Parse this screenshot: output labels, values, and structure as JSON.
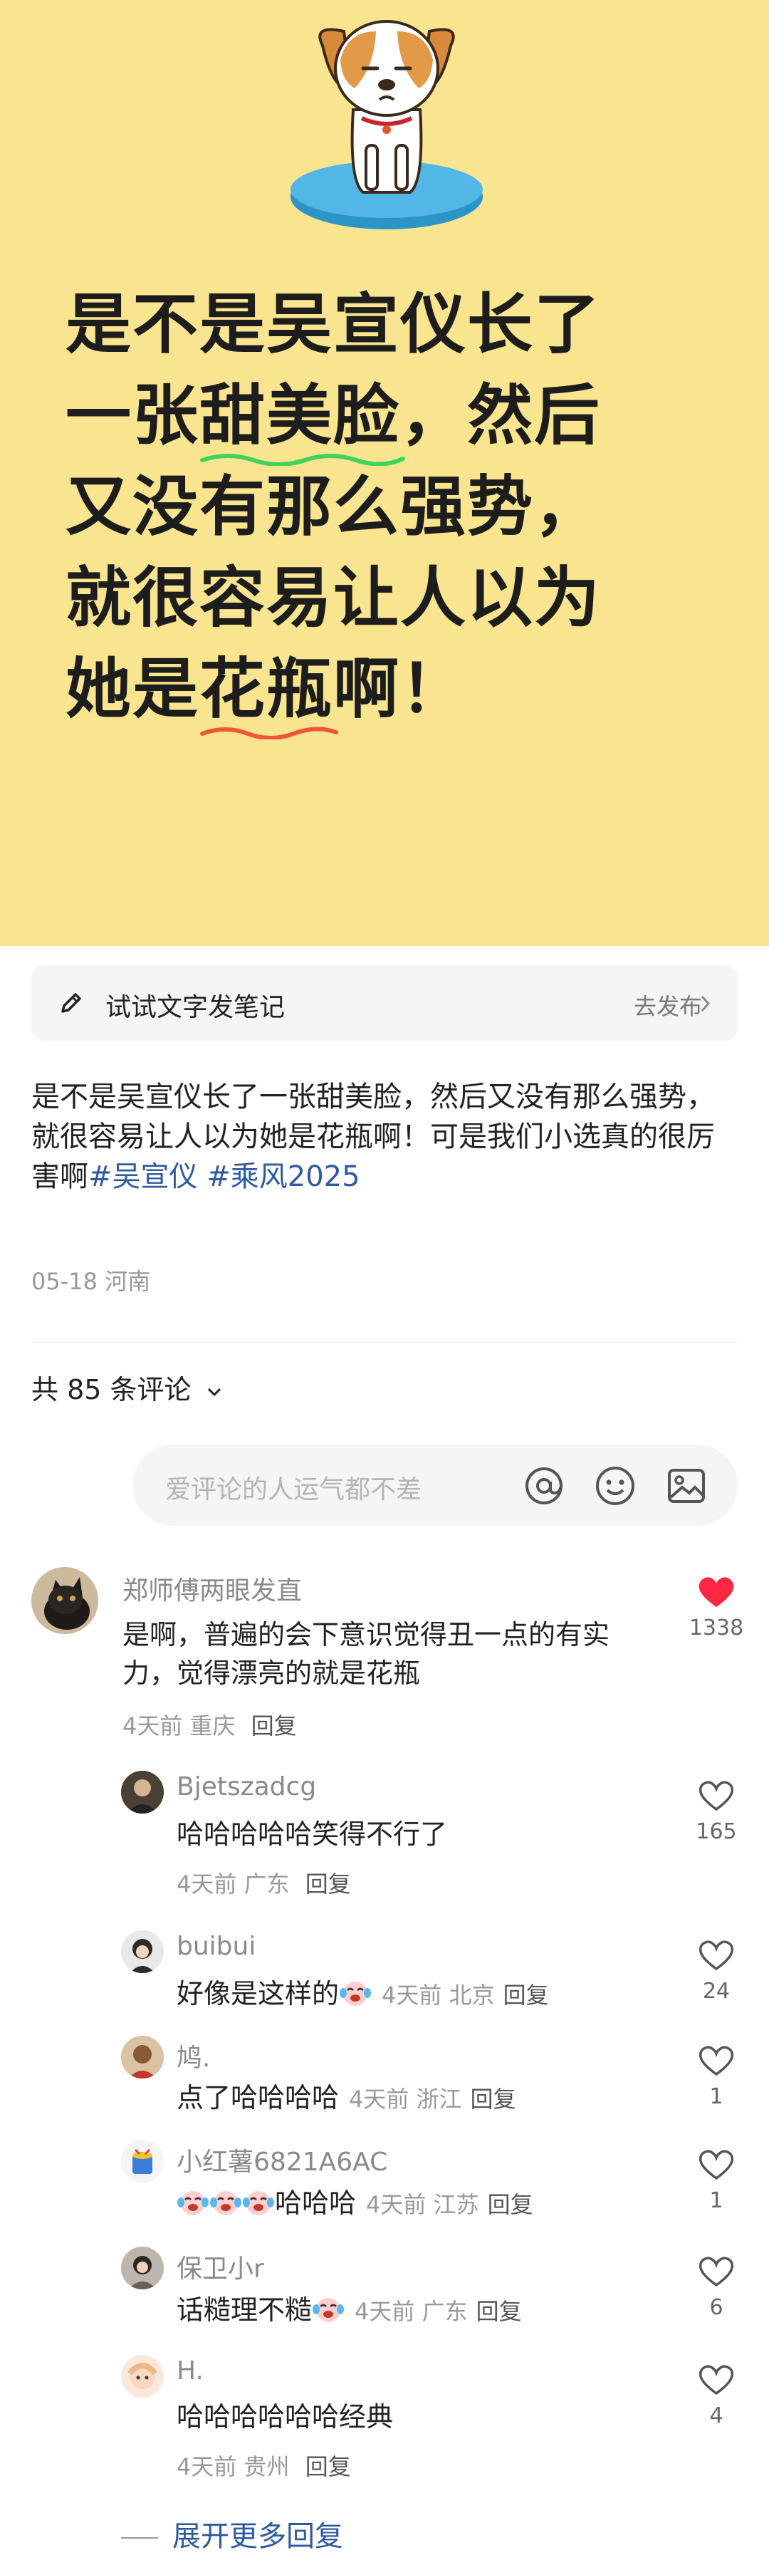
{
  "hero": {
    "line1": "是不是吴宣仪长了",
    "line2_pre": "一张",
    "line2_hl": "甜美脸",
    "line2_post": "，然后",
    "line3": "又没有那么强势，",
    "line4": "就很容易让人以为",
    "line5_pre": "她是",
    "line5_hl": "花瓶",
    "line5_post": "啊！"
  },
  "publish_bar": {
    "label": "试试文字发笔记",
    "action": "去发布"
  },
  "post": {
    "text": "是不是吴宣仪长了一张甜美脸，然后又没有那么强势，就很容易让人以为她是花瓶啊！可是我们小选真的很厉害啊",
    "tags": [
      "#吴宣仪",
      "#乘风2025"
    ],
    "date": "05-18",
    "location": "河南"
  },
  "comments_header": {
    "count_label": "共 85 条评论"
  },
  "comment_input": {
    "placeholder": "爱评论的人运气都不差",
    "icons": [
      "at-icon",
      "smile-icon",
      "image-icon"
    ]
  },
  "comments": [
    {
      "name": "郑师傅两眼发直",
      "text": "是啊，普遍的会下意识觉得丑一点的有实力，觉得漂亮的就是花瓶",
      "time": "4天前",
      "location": "重庆",
      "reply": "回复",
      "likes": "1338",
      "liked": true
    },
    {
      "name": "Bjetszadcg",
      "text": "哈哈哈哈哈笑得不行了",
      "time": "4天前",
      "location": "广东",
      "reply": "回复",
      "likes": "165"
    },
    {
      "name": "buibui",
      "text": "好像是这样的",
      "time": "4天前",
      "location": "北京",
      "reply": "回复",
      "likes": "24"
    },
    {
      "name": "鸠.",
      "text": "点了哈哈哈哈",
      "time": "4天前",
      "location": "浙江",
      "reply": "回复",
      "likes": "1"
    },
    {
      "name": "小红薯6821A6AC",
      "text": "哈哈哈",
      "time": "4天前",
      "location": "江苏",
      "reply": "回复",
      "likes": "1"
    },
    {
      "name": "保卫小r",
      "text": "话糙理不糙",
      "time": "4天前",
      "location": "广东",
      "reply": "回复",
      "likes": "6"
    },
    {
      "name": "H.",
      "text": "哈哈哈哈哈哈经典",
      "time": "4天前",
      "location": "贵州",
      "reply": "回复",
      "likes": "4"
    }
  ],
  "more_replies": "展开更多回复",
  "colors": {
    "hero_bg": "#f9e48f",
    "tag": "#2f5a9e",
    "like_red": "#ff2742",
    "wave_green": "#3ed45a",
    "wave_red": "#f0553a"
  }
}
